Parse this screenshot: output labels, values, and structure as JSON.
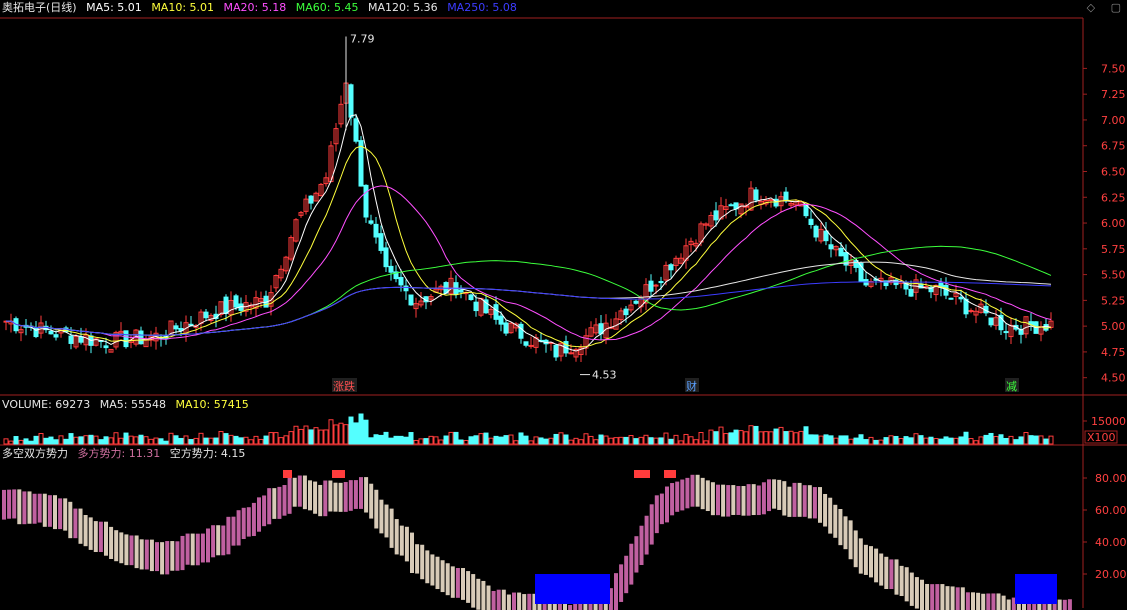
{
  "header": {
    "title": "奥拓电子(日线)",
    "ma": [
      {
        "label": "MA5: 5.01",
        "color": "#ffffff"
      },
      {
        "label": "MA10: 5.01",
        "color": "#ffff3c"
      },
      {
        "label": "MA20: 5.18",
        "color": "#ff4fff"
      },
      {
        "label": "MA60: 5.45",
        "color": "#3cff3c"
      },
      {
        "label": "MA120: 5.36",
        "color": "#e6e6e6"
      },
      {
        "label": "MA250: 5.08",
        "color": "#3c3cff"
      }
    ],
    "icons": [
      "diamond-icon",
      "restore-icon"
    ]
  },
  "volume_header": {
    "items": [
      {
        "label": "VOLUME: 69273",
        "color": "#e6e6e6"
      },
      {
        "label": "MA5: 55548",
        "color": "#e6e6e6"
      },
      {
        "label": "MA10: 57415",
        "color": "#ffff3c"
      }
    ]
  },
  "force_header": {
    "items": [
      {
        "label": "多空双方势力",
        "color": "#e6e6e6"
      },
      {
        "label": "多方势力: 11.31",
        "color": "#d070a0"
      },
      {
        "label": "空方势力: 4.15",
        "color": "#e6e6e6"
      }
    ]
  },
  "chart_data": [
    {
      "type": "candlestick",
      "yticks": [
        "7.50",
        "7.25",
        "7.00",
        "6.75",
        "6.50",
        "6.25",
        "6.00",
        "5.75",
        "5.50",
        "5.25",
        "5.00",
        "4.75",
        "4.50"
      ],
      "ylim": [
        4.4,
        7.95
      ],
      "annotations": [
        {
          "text": "7.79",
          "value": 7.79
        },
        {
          "text": "4.53",
          "value": 4.53
        }
      ],
      "markers": [
        {
          "text": "涨跌",
          "color": "#ff5050"
        },
        {
          "text": "财",
          "color": "#5aa0ff"
        },
        {
          "text": "减",
          "color": "#3cff3c"
        }
      ],
      "colors": {
        "up": "#ff3c3c",
        "down": "#54ffff"
      }
    },
    {
      "type": "bar",
      "name": "VOLUME",
      "yticks": [
        "15000"
      ],
      "unit_label": "X100"
    },
    {
      "type": "bar",
      "name": "多空双方势力",
      "yticks": [
        "80.00",
        "60.00",
        "40.00",
        "20.00"
      ],
      "ylim": [
        0,
        90
      ],
      "colors": {
        "bull": "#c060a0",
        "bear": "#d8cbb8",
        "extreme": "#0000ff"
      }
    }
  ]
}
